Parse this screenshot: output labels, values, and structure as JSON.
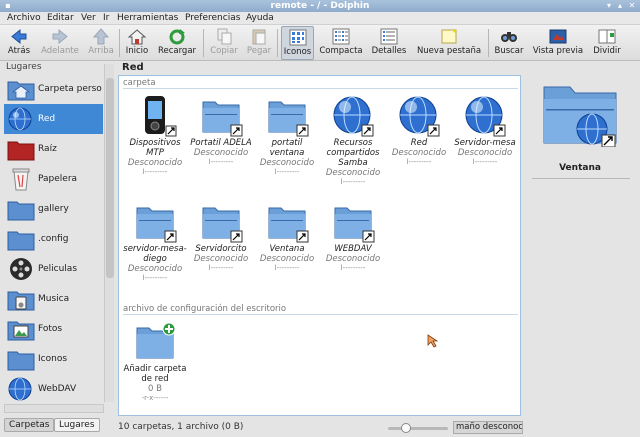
{
  "window": {
    "title": "remote - / - Dolphin"
  },
  "menu": [
    "Archivo",
    "Editar",
    "Ver",
    "Ir",
    "Herramientas",
    "Preferencias",
    "Ayuda"
  ],
  "toolbar": {
    "back": "Atrás",
    "forward": "Adelante",
    "up": "Arriba",
    "home": "Inicio",
    "reload": "Recargar",
    "copy": "Copiar",
    "paste": "Pegar",
    "icons": "Iconos",
    "compact": "Compacta",
    "details": "Detalles",
    "new_tab": "Nueva pestaña",
    "search": "Buscar",
    "preview": "Vista previa",
    "split": "Dividir"
  },
  "sidebar": {
    "header": "Lugares",
    "items": [
      {
        "label": "Carpeta personal",
        "icon": "home-folder-icon"
      },
      {
        "label": "Red",
        "icon": "network-globe-icon",
        "selected": true
      },
      {
        "label": "Raíz",
        "icon": "root-folder-icon"
      },
      {
        "label": "Papelera",
        "icon": "trash-icon"
      },
      {
        "label": "gallery",
        "icon": "folder-icon"
      },
      {
        "label": ".config",
        "icon": "folder-icon"
      },
      {
        "label": "Peliculas",
        "icon": "film-reel-icon"
      },
      {
        "label": "Musica",
        "icon": "music-folder-icon"
      },
      {
        "label": "Fotos",
        "icon": "pictures-folder-icon"
      },
      {
        "label": "Iconos",
        "icon": "folder-icon"
      },
      {
        "label": "WebDAV",
        "icon": "network-globe-icon"
      }
    ],
    "tabs": [
      "Carpetas",
      "Lugares"
    ]
  },
  "location": "Red",
  "groups": {
    "folder": "carpeta",
    "desktop": "archivo de configuración del escritorio"
  },
  "items": [
    {
      "name": "Dispositivos MTP",
      "sub": "Desconocido",
      "perm": "l---------",
      "icon": "mtp-device-icon"
    },
    {
      "name": "Portatil ADELA",
      "sub": "Desconocido",
      "perm": "l---------",
      "icon": "network-folder-icon"
    },
    {
      "name": "portatil ventana",
      "sub": "Desconocido",
      "perm": "l---------",
      "icon": "network-folder-icon"
    },
    {
      "name": "Recursos compartidos Samba",
      "sub": "Desconocido",
      "perm": "l---------",
      "icon": "network-globe-icon"
    },
    {
      "name": "Red",
      "sub": "Desconocido",
      "perm": "l---------",
      "icon": "network-globe-icon"
    },
    {
      "name": "Servidor-mesa",
      "sub": "Desconocido",
      "perm": "l---------",
      "icon": "network-globe-icon"
    },
    {
      "name": "servidor-mesa-diego",
      "sub": "Desconocido",
      "perm": "l---------",
      "icon": "network-folder-icon"
    },
    {
      "name": "Servidorcito",
      "sub": "Desconocido",
      "perm": "l---------",
      "icon": "network-folder-icon"
    },
    {
      "name": "Ventana",
      "sub": "Desconocido",
      "perm": "l---------",
      "icon": "network-folder-icon"
    },
    {
      "name": "WEBDAV",
      "sub": "Desconocido",
      "perm": "l---------",
      "icon": "network-folder-icon"
    }
  ],
  "desktop_item": {
    "name": "Añadir carpeta de red",
    "size": "0 B",
    "perm": "-r-x------",
    "icon": "add-network-folder-icon"
  },
  "preview": {
    "name": "Ventana"
  },
  "status": {
    "text": "10 carpetas, 1 archivo (0 B)",
    "space": "maño desconoci",
    "zoom_fraction": 0.25
  }
}
